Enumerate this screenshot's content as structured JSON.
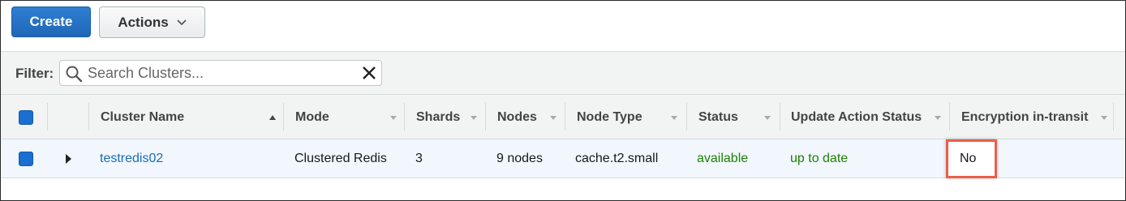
{
  "toolbar": {
    "create_label": "Create",
    "actions_label": "Actions"
  },
  "filter": {
    "label": "Filter:",
    "placeholder": "Search Clusters...",
    "value": ""
  },
  "columns": {
    "cluster_name": "Cluster Name",
    "mode": "Mode",
    "shards": "Shards",
    "nodes": "Nodes",
    "node_type": "Node Type",
    "status": "Status",
    "update_action_status": "Update Action Status",
    "encryption_in_transit": "Encryption in-transit"
  },
  "rows": [
    {
      "cluster_name": "testredis02",
      "mode": "Clustered Redis",
      "shards": "3",
      "nodes": "9 nodes",
      "node_type": "cache.t2.small",
      "status": "available",
      "update_action_status": "up to date",
      "encryption_in_transit": "No"
    }
  ],
  "colors": {
    "primary": "#1a6fd0",
    "status_green": "#1d8102",
    "link": "#1a6bb8",
    "highlight": "#e8604a"
  },
  "icons": [
    "search-icon",
    "clear-icon",
    "chevron-down-icon",
    "sort-ascending-icon",
    "expand-row-icon"
  ]
}
